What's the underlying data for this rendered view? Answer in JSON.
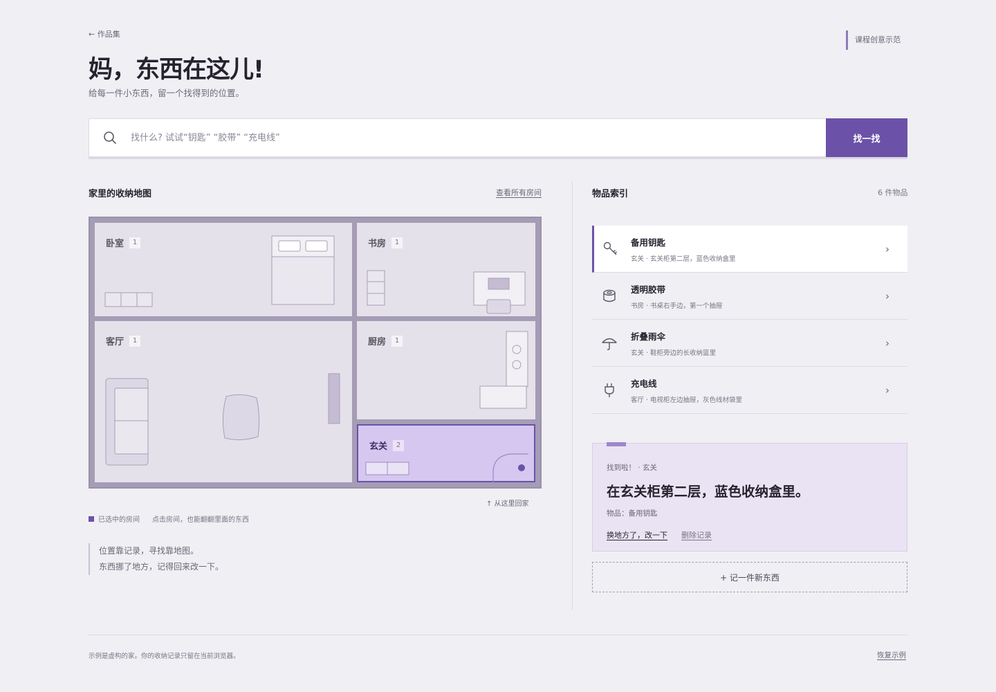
{
  "nav": {
    "back_label": "← 作品集",
    "course_tag": "课程创意示范"
  },
  "hero": {
    "title": "妈，东西在这儿!",
    "subtitle": "给每一件小东西，留一个找得到的位置。"
  },
  "search": {
    "placeholder": "找什么? 试试“钥匙” “胶带” “充电线”",
    "value": "",
    "button_label": "找一找",
    "icon": "search-icon"
  },
  "map_section": {
    "title": "家里的收纳地图",
    "view_all": "查看所有房间",
    "rooms": [
      {
        "name": "卧室",
        "count": "1",
        "selected": false
      },
      {
        "name": "书房",
        "count": "1",
        "selected": false
      },
      {
        "name": "客厅",
        "count": "1",
        "selected": false
      },
      {
        "name": "厨房",
        "count": "1",
        "selected": false
      },
      {
        "name": "玄关",
        "count": "2",
        "selected": true
      }
    ],
    "entrance_hint": "↑ 从这里回家",
    "legend_selected": "已选中的房间",
    "legend_hint": "点击房间，也能翻翻里面的东西",
    "quote_line1": "位置靠记录，寻找靠地图。",
    "quote_line2": "东西挪了地方，记得回来改一下。"
  },
  "index_section": {
    "title": "物品索引",
    "count": "6 件物品",
    "items": [
      {
        "name": "备用钥匙",
        "location": "玄关 · 玄关柜第二层，蓝色收纳盒里",
        "icon": "key-icon",
        "active": true
      },
      {
        "name": "透明胶带",
        "location": "书房 · 书桌右手边，第一个抽屉",
        "icon": "tape-icon",
        "active": false
      },
      {
        "name": "折叠雨伞",
        "location": "玄关 · 鞋柜旁边的长收纳篮里",
        "icon": "umbrella-icon",
        "active": false
      },
      {
        "name": "充电线",
        "location": "客厅 · 电视柜左边抽屉，灰色线材袋里",
        "icon": "plug-icon",
        "active": false
      }
    ]
  },
  "found_card": {
    "tag": "找到啦！ · 玄关",
    "title": "在玄关柜第二层，蓝色收纳盒里。",
    "item_line": "物品：备用钥匙",
    "edit_label": "换地方了，改一下",
    "delete_label": "删除记录"
  },
  "add_button": "+ 记一件新东西",
  "footer": {
    "note": "示例是虚构的家。你的收纳记录只留在当前浏览器。",
    "reset": "恢复示例"
  },
  "colors": {
    "accent": "#6b52a8",
    "selected_room": "#d6c7f0",
    "page_bg": "#f0eff4"
  }
}
